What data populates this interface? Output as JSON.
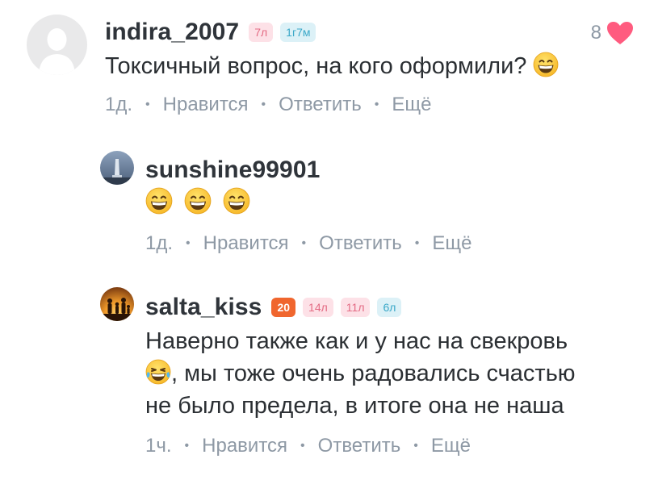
{
  "comments": [
    {
      "username": "indira_2007",
      "badges": [
        {
          "text": "7л",
          "bg": "#fde1e7",
          "color": "#e46b84"
        },
        {
          "text": "1г7м",
          "bg": "#dcf1f7",
          "color": "#3aa8c8"
        }
      ],
      "text": "Токсичный вопрос, на кого оформили?",
      "emoji": [
        "grin-face-icon"
      ],
      "time": "1д.",
      "like_label": "Нравится",
      "reply_label": "Ответить",
      "more_label": "Ещё",
      "likes": "8"
    },
    {
      "username": "sunshine99901",
      "badges": [],
      "text": "",
      "emoji": [
        "grin-face-icon",
        "grin-face-icon",
        "grin-face-icon"
      ],
      "time": "1д.",
      "like_label": "Нравится",
      "reply_label": "Ответить",
      "more_label": "Ещё"
    },
    {
      "username": "salta_kiss",
      "badges": [
        {
          "text": "20",
          "bg": "#f0662e",
          "color": "#ffffff"
        },
        {
          "text": "14л",
          "bg": "#fde1e7",
          "color": "#e46b84"
        },
        {
          "text": "11л",
          "bg": "#fde1e7",
          "color": "#e46b84"
        },
        {
          "text": "6л",
          "bg": "#dcf1f7",
          "color": "#3aa8c8"
        }
      ],
      "text_line1": "Наверно также как и у нас на свекровь",
      "text_line2": ", мы тоже очень радовались счастью",
      "text_line3": "не было предела, в итоге она не наша",
      "emoji": [
        "tears-of-joy-face-icon"
      ],
      "time": "1ч.",
      "like_label": "Нравится",
      "reply_label": "Ответить",
      "more_label": "Ещё"
    }
  ],
  "colors": {
    "heart": "#ff5b7f",
    "meta": "#8e99a5"
  }
}
